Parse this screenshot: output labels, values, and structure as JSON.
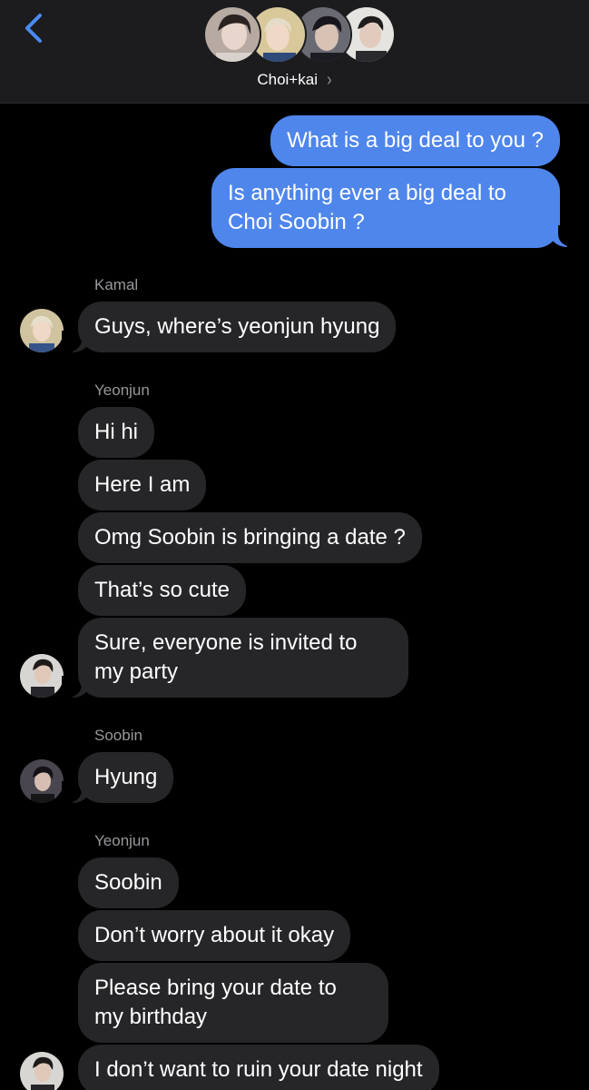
{
  "header": {
    "group_name": "Choi+kai",
    "chevron": "chevron-right-icon",
    "back_icon": "chevron-left-icon",
    "accent_color": "#4a8af4"
  },
  "messages": {
    "out_1": "What is a big deal to you ?",
    "out_2_line1": "Is anything ever a big deal to",
    "out_2_line2": "Choi Soobin ?",
    "kamal_name": "Kamal",
    "kamal_1": "Guys, where’s yeonjun hyung",
    "yeonjun_name_1": "Yeonjun",
    "yeonjun_1": "Hi hi",
    "yeonjun_2": "Here I am",
    "yeonjun_3": "Omg Soobin is bringing a date ?",
    "yeonjun_4": "That’s so cute",
    "yeonjun_5_line1": "Sure, everyone is invited to",
    "yeonjun_5_line2": "my party",
    "soobin_name": "Soobin",
    "soobin_1": "Hyung",
    "yeonjun_name_2": "Yeonjun",
    "yeonjun_6": "Soobin",
    "yeonjun_7": "Don’t worry about it okay",
    "yeonjun_8_line1": "Please bring your date to",
    "yeonjun_8_line2": "my birthday",
    "yeonjun_9": "I don’t want to ruin your date night"
  },
  "colors": {
    "outgoing_bubble": "#4f86ec",
    "incoming_bubble": "#262629",
    "header_bg": "#1c1c1e"
  }
}
